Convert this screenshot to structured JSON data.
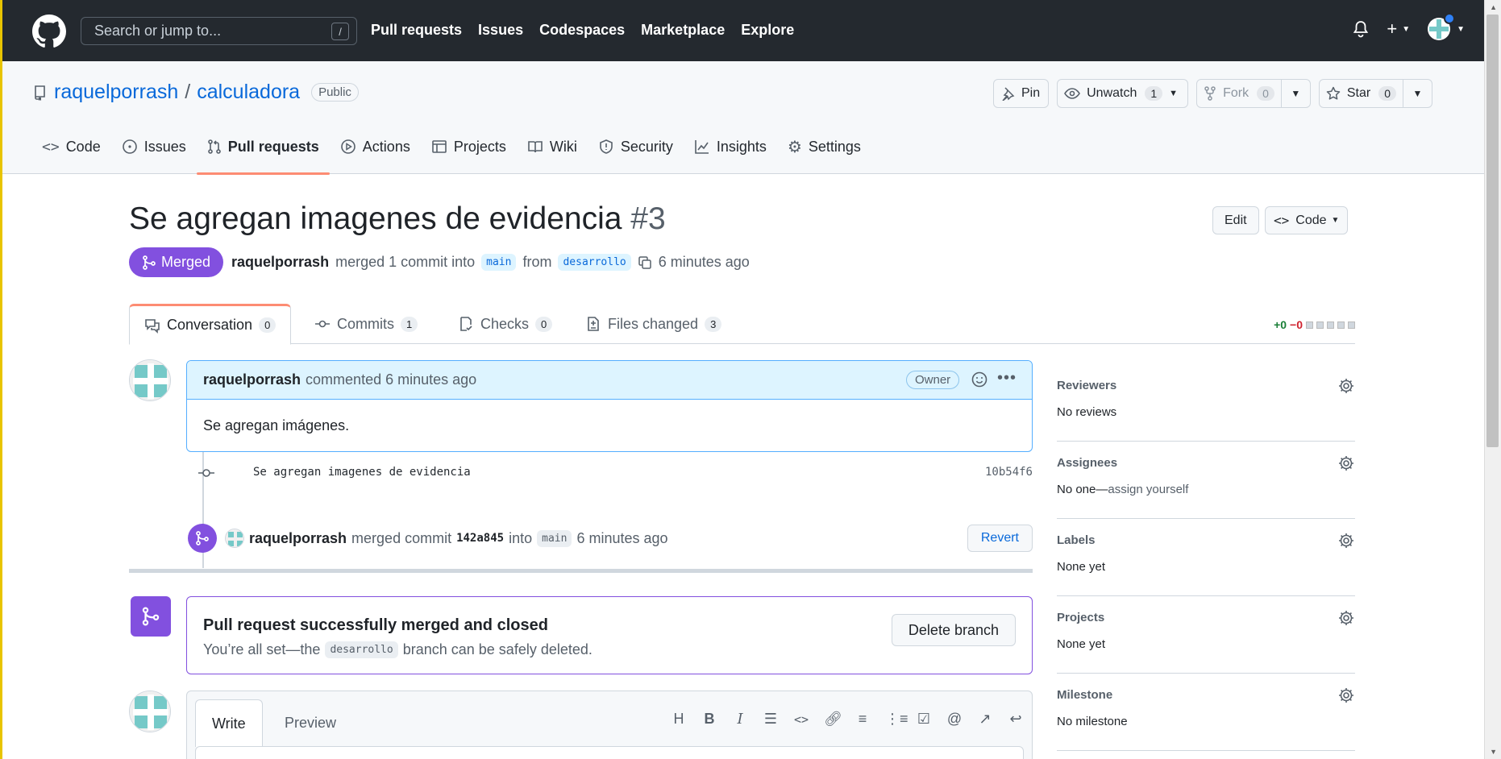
{
  "header": {
    "search_placeholder": "Search or jump to...",
    "search_shortcut": "/",
    "nav": [
      "Pull requests",
      "Issues",
      "Codespaces",
      "Marketplace",
      "Explore"
    ]
  },
  "repo": {
    "owner": "raquelporrash",
    "separator": "/",
    "name": "calculadora",
    "visibility": "Public",
    "pin_label": "Pin",
    "watch_label": "Unwatch",
    "watch_count": "1",
    "fork_label": "Fork",
    "fork_count": "0",
    "star_label": "Star",
    "star_count": "0",
    "tabs": [
      "Code",
      "Issues",
      "Pull requests",
      "Actions",
      "Projects",
      "Wiki",
      "Security",
      "Insights",
      "Settings"
    ],
    "active_tab": "Pull requests"
  },
  "pr": {
    "title": "Se agregan imagenes de evidencia",
    "number": "#3",
    "edit_label": "Edit",
    "code_label": "Code",
    "status": "Merged",
    "author": "raquelporrash",
    "meta_text": "merged 1 commit into",
    "base_branch": "main",
    "from_text": "from",
    "head_branch": "desarrollo",
    "time": "6 minutes ago",
    "tabs": {
      "conversation": {
        "label": "Conversation",
        "count": "0"
      },
      "commits": {
        "label": "Commits",
        "count": "1"
      },
      "checks": {
        "label": "Checks",
        "count": "0"
      },
      "files": {
        "label": "Files changed",
        "count": "3"
      }
    },
    "diff_add": "+0",
    "diff_del": "−0"
  },
  "comment": {
    "author": "raquelporrash",
    "action": "commented 6 minutes ago",
    "role": "Owner",
    "body": "Se agregan imágenes."
  },
  "commit": {
    "message": "Se agregan imagenes de evidencia",
    "sha": "10b54f6"
  },
  "merge_event": {
    "author": "raquelporrash",
    "text": "merged commit",
    "sha": "142a845",
    "into": "into",
    "branch": "main",
    "time": "6 minutes ago",
    "revert_label": "Revert"
  },
  "merged_box": {
    "heading": "Pull request successfully merged and closed",
    "text_before": "You’re all set—the",
    "branch": "desarrollo",
    "text_after": "branch can be safely deleted.",
    "delete_label": "Delete branch"
  },
  "editor": {
    "write_tab": "Write",
    "preview_tab": "Preview"
  },
  "sidebar": {
    "reviewers": {
      "title": "Reviewers",
      "value": "No reviews"
    },
    "assignees": {
      "title": "Assignees",
      "value_prefix": "No one—",
      "value_link": "assign yourself"
    },
    "labels": {
      "title": "Labels",
      "value": "None yet"
    },
    "projects": {
      "title": "Projects",
      "value": "None yet"
    },
    "milestone": {
      "title": "Milestone",
      "value": "No milestone"
    }
  },
  "colors": {
    "header_bg": "#24292f",
    "merged_purple": "#8250df",
    "link_blue": "#0969da",
    "tab_underline": "#fd8c73"
  }
}
